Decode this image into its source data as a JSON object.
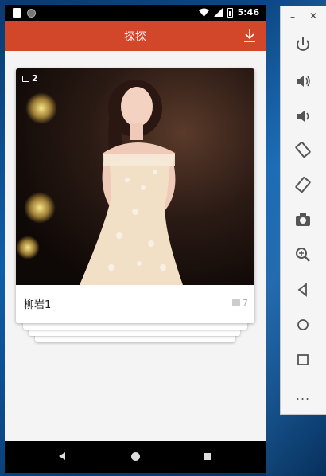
{
  "statusbar": {
    "time": "5:46"
  },
  "appbar": {
    "title": "探探"
  },
  "card": {
    "photo_count": "2",
    "title": "柳岩1",
    "count": "7"
  },
  "emulator": {
    "minimize": "–",
    "close": "✕",
    "more": "..."
  },
  "colors": {
    "appbar": "#d2462a",
    "background": "#f4f4f4"
  }
}
